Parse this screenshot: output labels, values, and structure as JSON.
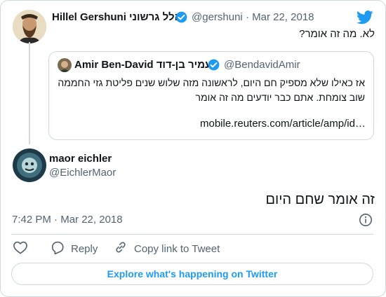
{
  "colors": {
    "accent": "#1d9bf0",
    "muted": "#536471",
    "border": "#cfd9de"
  },
  "parent_tweet": {
    "display_name": "Hillel Gershuni הלל גרשוני",
    "handle": "@gershuni",
    "sep": "·",
    "date": "Mar 22, 2018",
    "text": "לא. מה זה אומר?"
  },
  "quoted_tweet": {
    "display_name": "Amir Ben-David עמיר בן-דוד",
    "handle": "@BendavidAmir",
    "text": "אז כאילו שלא מספיק חם היום, לראשונה מזה שלוש שנים פליטת גזי החממה שוב צומחת. אתם כבר יודעים מה זה אומר",
    "link": "mobile.reuters.com/article/amp/id…"
  },
  "main_tweet": {
    "display_name": "maor eichler",
    "handle": "@EichlerMaor",
    "text": "זה אומר שחם היום",
    "time": "7:42 PM",
    "sep": "·",
    "date": "Mar 22, 2018"
  },
  "actions": {
    "reply_label": "Reply",
    "copy_label": "Copy link to Tweet"
  },
  "explore_label": "Explore what's happening on Twitter",
  "icons": [
    "twitter-bird-icon",
    "verified-badge-icon",
    "info-icon",
    "heart-icon",
    "reply-icon",
    "link-icon"
  ]
}
